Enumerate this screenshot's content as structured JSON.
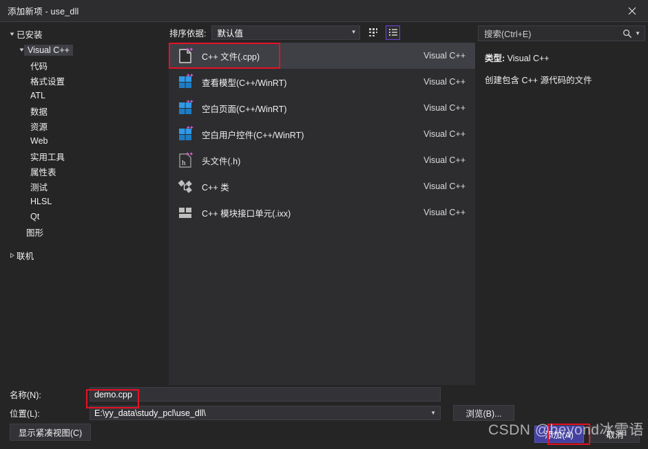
{
  "window": {
    "title": "添加新项 - use_dll",
    "close_icon": "close-icon"
  },
  "sidebar": {
    "installed_label": "已安装",
    "root": {
      "label": "Visual C++",
      "selected": true
    },
    "children": [
      {
        "label": "代码"
      },
      {
        "label": "格式设置"
      },
      {
        "label": "ATL"
      },
      {
        "label": "数据"
      },
      {
        "label": "资源"
      },
      {
        "label": "Web"
      },
      {
        "label": "实用工具"
      },
      {
        "label": "属性表"
      },
      {
        "label": "测试"
      },
      {
        "label": "HLSL"
      },
      {
        "label": "Qt"
      }
    ],
    "graphics_label": "图形",
    "online_label": "联机"
  },
  "toolbar": {
    "sort_label": "排序依据:",
    "sort_value": "默认值",
    "grid_view_icon": "grid-view-icon",
    "list_view_icon": "list-view-icon"
  },
  "templates": [
    {
      "name": "C++ 文件(.cpp)",
      "category": "Visual C++",
      "icon": "cpp-file-icon",
      "selected": true
    },
    {
      "name": "查看模型(C++/WinRT)",
      "category": "Visual C++",
      "icon": "winrt-window-icon",
      "selected": false
    },
    {
      "name": "空白页面(C++/WinRT)",
      "category": "Visual C++",
      "icon": "winrt-window-icon",
      "selected": false
    },
    {
      "name": "空白用户控件(C++/WinRT)",
      "category": "Visual C++",
      "icon": "winrt-window-icon",
      "selected": false
    },
    {
      "name": "头文件(.h)",
      "category": "Visual C++",
      "icon": "header-file-icon",
      "selected": false
    },
    {
      "name": "C++ 类",
      "category": "Visual C++",
      "icon": "cpp-class-icon",
      "selected": false
    },
    {
      "name": "C++ 模块接口单元(.ixx)",
      "category": "Visual C++",
      "icon": "cpp-module-icon",
      "selected": false
    }
  ],
  "search": {
    "placeholder": "搜索(Ctrl+E)",
    "icon": "search-icon",
    "dropdown_icon": "chevron-down-icon"
  },
  "details": {
    "type_label": "类型:",
    "type_value": "Visual C++",
    "description": "创建包含 C++ 源代码的文件"
  },
  "footer": {
    "name_label": "名称(N):",
    "name_value": "demo.cpp",
    "location_label": "位置(L):",
    "location_value": "E:\\yy_data\\study_pcl\\use_dll\\",
    "browse_label": "浏览(B)...",
    "compact_label": "显示紧凑视图(C)",
    "add_label": "添加(A)",
    "cancel_label": "取消"
  },
  "watermark": {
    "text": "CSDN @beyond冰雪语"
  },
  "colors": {
    "accent": "#4440a0",
    "highlight_border": "#e81123",
    "view_toggle_border": "#6f42e0",
    "panel_bg": "#2d2d30",
    "dialog_bg": "#252526"
  }
}
